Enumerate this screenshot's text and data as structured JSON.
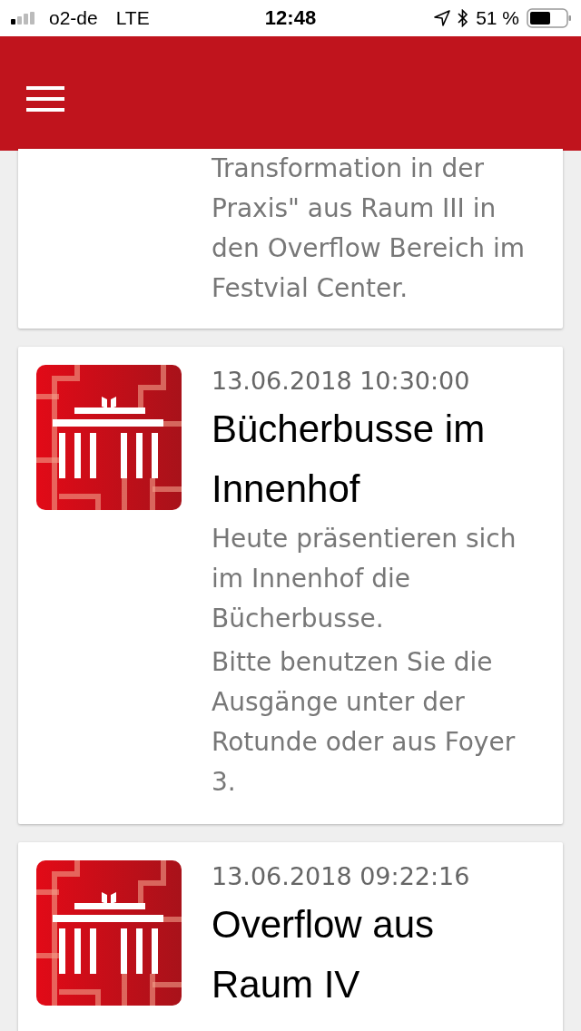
{
  "status_bar": {
    "carrier": "o2-de",
    "network": "LTE",
    "time": "12:48",
    "battery": "51 %"
  },
  "cards": [
    {
      "partial": true,
      "paragraphs": [
        "Transformation in der Praxis\" aus Raum III in den Overflow Bereich im Festvial Center."
      ]
    },
    {
      "partial": false,
      "date": "13.06.2018 10:30:00",
      "title": "Bücherbusse im Innenhof",
      "paragraphs": [
        "Heute präsentieren sich im Innenhof die Bücherbusse.",
        "Bitte benutzen Sie die Ausgänge unter der Rotunde oder aus Foyer 3."
      ]
    },
    {
      "partial": false,
      "date": "13.06.2018 09:22:16",
      "title": "Overflow aus Raum IV"
    }
  ]
}
